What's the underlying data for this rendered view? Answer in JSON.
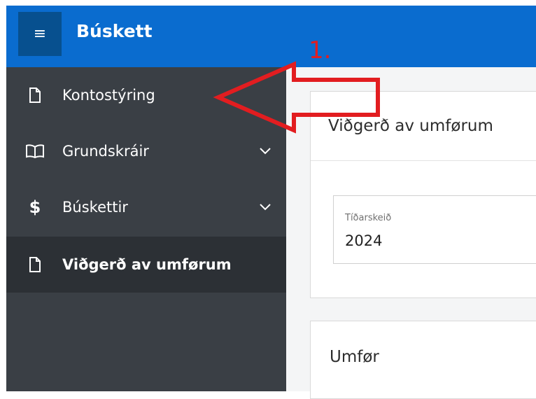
{
  "app": {
    "title": "Búskett",
    "menu_icon": "hamburger-icon",
    "accent_color": "#0a6ccf"
  },
  "sidebar": {
    "items": [
      {
        "label": "Kontostýring",
        "icon": "page-icon",
        "expandable": false,
        "active": false
      },
      {
        "label": "Grundskráir",
        "icon": "book-icon",
        "expandable": true,
        "active": false
      },
      {
        "label": "Búskettir",
        "icon": "dollar-icon",
        "expandable": true,
        "active": false
      },
      {
        "label": "Viðgerð av umførum",
        "icon": "page-icon",
        "expandable": false,
        "active": true
      }
    ]
  },
  "main": {
    "region_title": "Viðgerð av umførum",
    "field": {
      "label": "Tíðarskeið",
      "value": "2024"
    },
    "region2_title": "Umfør"
  },
  "annotation": {
    "number": "1.",
    "color": "#e21d20"
  }
}
